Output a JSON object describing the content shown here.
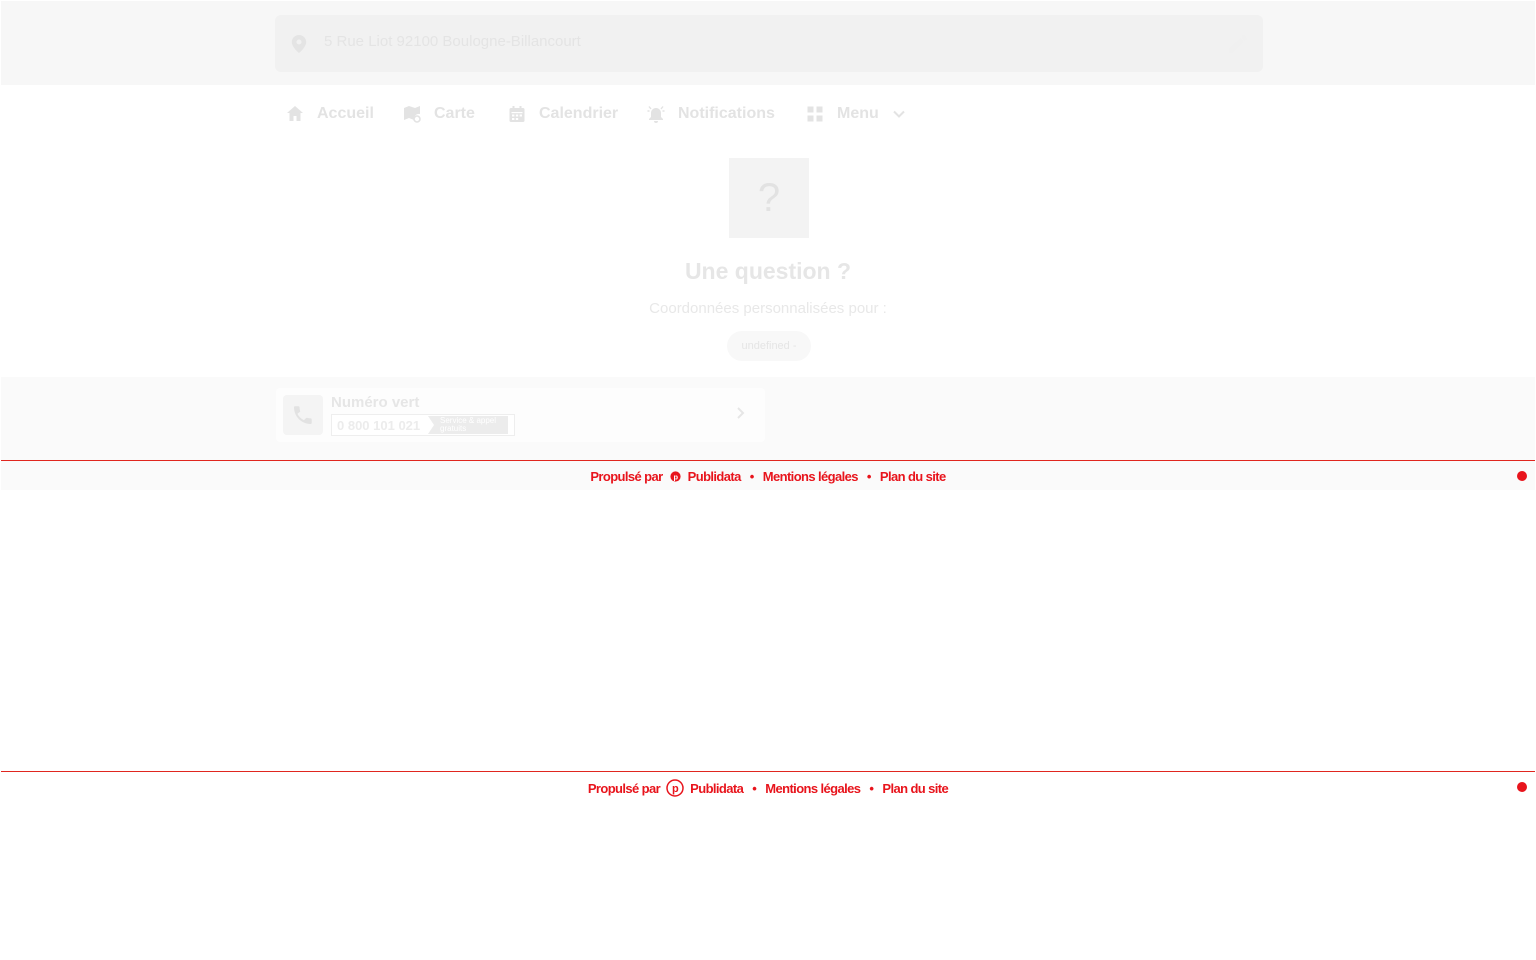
{
  "address": {
    "text": "5 Rue Liot 92100 Boulogne-Billancourt",
    "icons": {
      "location": "map-pin-icon",
      "edit": "pencil-icon"
    }
  },
  "nav": {
    "items": [
      {
        "label": "Accueil",
        "icon": "home-icon"
      },
      {
        "label": "Carte",
        "icon": "map-icon"
      },
      {
        "label": "Calendrier",
        "icon": "calendar-icon"
      },
      {
        "label": "Notifications",
        "icon": "bell-alert-icon"
      },
      {
        "label": "Menu",
        "icon": "grid-icon"
      }
    ]
  },
  "question": {
    "glyph": "?",
    "title": "Une question ?",
    "subtitle": "Coordonnées personnalisées pour :",
    "chip": "undefined -"
  },
  "contact": {
    "title": "Numéro vert",
    "number": "0 800 101 021",
    "badge_line1": "Service & appel",
    "badge_line2": "gratuits"
  },
  "footer": {
    "powered_by": "Propulsé par",
    "brand": "Publidata",
    "legal": "Mentions légales",
    "sitemap": "Plan du site",
    "separator": "•",
    "accent_color": "#e8141c"
  }
}
